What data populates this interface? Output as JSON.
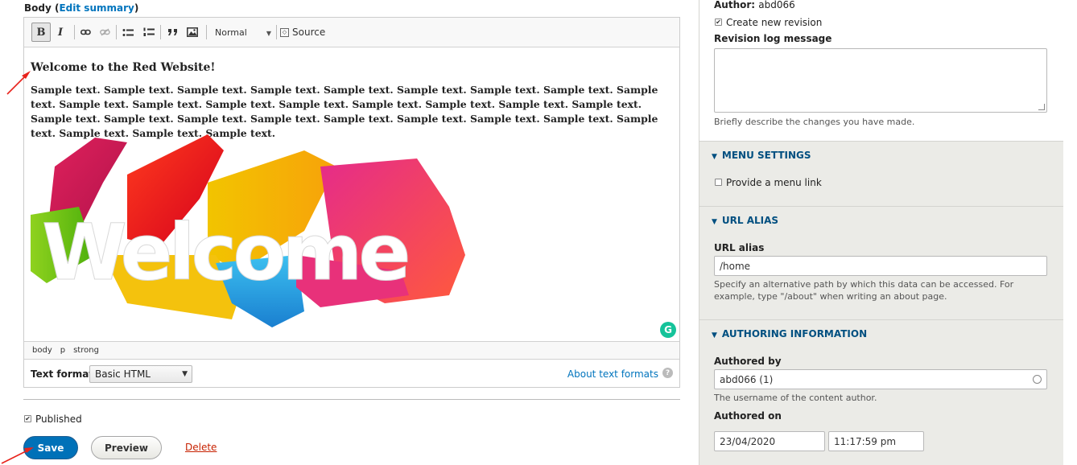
{
  "body_field": {
    "label": "Body",
    "paren_open": "(",
    "paren_close": ")",
    "edit_summary": "Edit summary"
  },
  "toolbar": {
    "bold": "B",
    "italic": "I",
    "format_value": "Normal",
    "source_label": "Source",
    "source_icon": "◇"
  },
  "content": {
    "heading": "Welcome to the Red Website!",
    "paragraph": "Sample text. Sample text. Sample text. Sample text. Sample text. Sample text. Sample text. Sample text. Sample text. Sample text. Sample text. Sample text. Sample text. Sample text. Sample text. Sample text. Sample text. Sample text. Sample text. Sample text. Sample text. Sample text. Sample text. Sample text. Sample text. Sample text. Sample text. Sample text. Sample text.",
    "image_text": "Welcome"
  },
  "grammarly_icon": "G",
  "element_path": [
    "body",
    "p",
    "strong"
  ],
  "text_format": {
    "label": "Text format",
    "value": "Basic HTML",
    "about_link": "About text formats",
    "help_icon": "?"
  },
  "published": {
    "label": "Published",
    "checked": true
  },
  "actions": {
    "save": "Save",
    "preview": "Preview",
    "delete": "Delete"
  },
  "sidebar": {
    "author_label": "Author:",
    "author_value": "abd066",
    "create_revision": "Create new revision",
    "revision_log_label": "Revision log message",
    "revision_log_desc": "Briefly describe the changes you have made.",
    "menu_settings": {
      "title": "MENU SETTINGS",
      "provide_link": "Provide a menu link"
    },
    "url_alias": {
      "title": "URL ALIAS",
      "label": "URL alias",
      "value": "/home",
      "desc": "Specify an alternative path by which this data can be accessed. For example, type \"/about\" when writing an about page."
    },
    "authoring": {
      "title": "AUTHORING INFORMATION",
      "authored_by_label": "Authored by",
      "authored_by_value": "abd066 (1)",
      "authored_by_desc": "The username of the content author.",
      "authored_on_label": "Authored on",
      "date": "23/04/2020",
      "time": "11:17:59 pm"
    },
    "triangle": "▼"
  },
  "colors": {
    "link": "#0074bd",
    "save_button": "#0071b8",
    "delete_link": "#c72100",
    "sidebar_bg": "#ebebe7",
    "annotation_arrow": "#e8231c"
  }
}
